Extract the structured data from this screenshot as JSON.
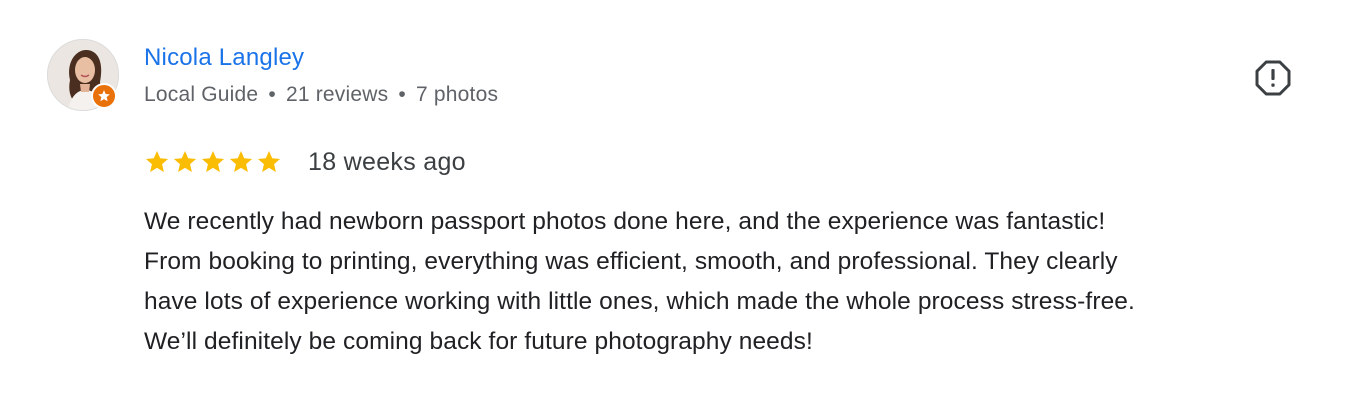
{
  "reviewer": {
    "name": "Nicola Langley",
    "role": "Local Guide",
    "separator": "•",
    "reviews": "21 reviews",
    "photos": "7 photos"
  },
  "rating": {
    "stars": 5,
    "max": 5,
    "age": "18 weeks ago"
  },
  "review_lines": [
    "We recently had newborn passport photos done here, and the experience was fantastic!",
    "From booking to printing, everything was efficient, smooth, and professional. They clearly",
    "have lots of experience working with little ones, which made the whole process stress-free.",
    "We’ll definitely be coming back for future photography needs!"
  ],
  "icons": {
    "avatar": "reviewer-avatar-photo",
    "badge": "local-guide-star-icon",
    "report": "report-flag-icon",
    "star": "star-icon"
  },
  "colors": {
    "name": "#1a73e8",
    "star": "#fbbc04",
    "badge": "#e8710a",
    "meta": "#5f6368",
    "text": "#202124"
  }
}
